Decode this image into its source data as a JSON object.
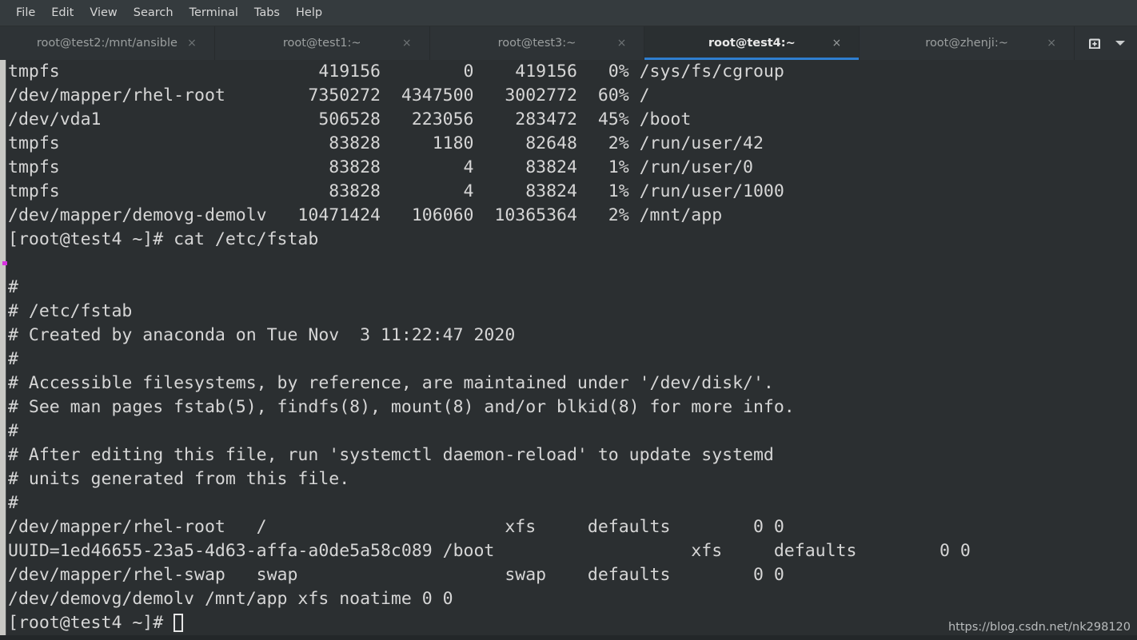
{
  "menu": {
    "items": [
      {
        "label": "File"
      },
      {
        "label": "Edit"
      },
      {
        "label": "View"
      },
      {
        "label": "Search"
      },
      {
        "label": "Terminal"
      },
      {
        "label": "Tabs"
      },
      {
        "label": "Help"
      }
    ]
  },
  "tabs": {
    "close_glyph": "×",
    "items": [
      {
        "label": "root@test2:/mnt/ansible",
        "active": false
      },
      {
        "label": "root@test1:~",
        "active": false
      },
      {
        "label": "root@test3:~",
        "active": false
      },
      {
        "label": "root@test4:~",
        "active": true
      },
      {
        "label": "root@zhenji:~",
        "active": false
      }
    ],
    "controls": {
      "new_tab_icon": "new-tab-icon",
      "menu_caret_icon": "chevron-down-icon"
    }
  },
  "terminal": {
    "active_tab_accent": "#2f7fd0",
    "background": "#2b2f31",
    "foreground": "#d6d6d6",
    "lines": [
      "tmpfs                         419156        0    419156   0% /sys/fs/cgroup",
      "/dev/mapper/rhel-root        7350272  4347500   3002772  60% /",
      "/dev/vda1                     506528   223056    283472  45% /boot",
      "tmpfs                          83828     1180     82648   2% /run/user/42",
      "tmpfs                          83828        4     83824   1% /run/user/0",
      "tmpfs                          83828        4     83824   1% /run/user/1000",
      "/dev/mapper/demovg-demolv   10471424   106060  10365364   2% /mnt/app",
      "[root@test4 ~]# cat /etc/fstab",
      "",
      "#",
      "# /etc/fstab",
      "# Created by anaconda on Tue Nov  3 11:22:47 2020",
      "#",
      "# Accessible filesystems, by reference, are maintained under '/dev/disk/'.",
      "# See man pages fstab(5), findfs(8), mount(8) and/or blkid(8) for more info.",
      "#",
      "# After editing this file, run 'systemctl daemon-reload' to update systemd",
      "# units generated from this file.",
      "#",
      "/dev/mapper/rhel-root   /                       xfs     defaults        0 0",
      "UUID=1ed46655-23a5-4d63-affa-a0de5a58c089 /boot                   xfs     defaults        0 0",
      "/dev/mapper/rhel-swap   swap                    swap    defaults        0 0",
      "/dev/demovg/demolv /mnt/app xfs noatime 0 0"
    ],
    "prompt": "[root@test4 ~]# ",
    "cursor": "block-cursor"
  },
  "watermark": {
    "text": "https://blog.csdn.net/nk298120"
  }
}
